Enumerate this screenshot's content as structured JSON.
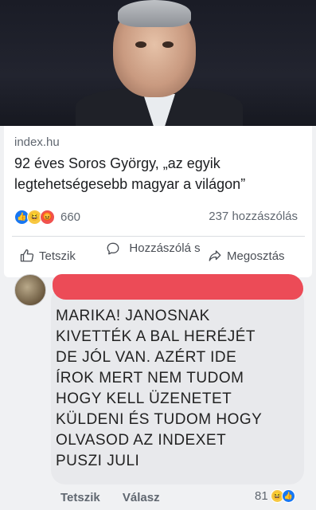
{
  "post": {
    "source": "index.hu",
    "headline": "92 éves Soros György, „az egyik legtehetségesebb magyar a világon”",
    "reaction_count": "660",
    "comments_count": "237 hozzászólás"
  },
  "actions": {
    "like": "Tetszik",
    "comment": "Hozzászólá s",
    "share": "Megosztás"
  },
  "comment": {
    "text": "MARIKA! JANOSNAK\nKIVETTÉK A BAL HERÉJÉT\nDE JÓL VAN. AZÉRT IDE\nÍROK MERT NEM TUDOM\nHOGY KELL ÜZENETET\nKÜLDENI ÉS TUDOM HOGY\nOLVASOD AZ INDEXET\nPUSZI JULI",
    "like_label": "Tetszik",
    "reply_label": "Válasz",
    "reaction_count": "81"
  },
  "colors": {
    "like_blue": "#1877f2",
    "haha_yellow": "#f7c842",
    "angry_red": "#f0524f",
    "redaction_red": "#ec4b57"
  }
}
